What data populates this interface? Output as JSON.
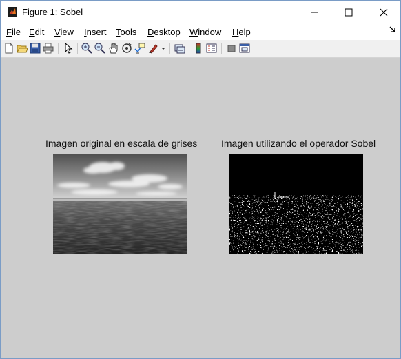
{
  "window": {
    "title": "Figure 1: Sobel"
  },
  "menu": {
    "items": [
      {
        "label": "File",
        "mnemonic": "F",
        "rest": "ile"
      },
      {
        "label": "Edit",
        "mnemonic": "E",
        "rest": "dit"
      },
      {
        "label": "View",
        "mnemonic": "V",
        "rest": "iew"
      },
      {
        "label": "Insert",
        "mnemonic": "I",
        "rest": "nsert"
      },
      {
        "label": "Tools",
        "mnemonic": "T",
        "rest": "ools"
      },
      {
        "label": "Desktop",
        "mnemonic": "D",
        "rest": "esktop"
      },
      {
        "label": "Window",
        "mnemonic": "W",
        "rest": "indow"
      },
      {
        "label": "Help",
        "mnemonic": "H",
        "rest": "elp"
      }
    ]
  },
  "toolbar": {
    "icons": [
      "new-figure-icon",
      "open-file-icon",
      "save-icon",
      "print-icon",
      "edit-plot-arrow-icon",
      "zoom-in-icon",
      "zoom-out-icon",
      "pan-hand-icon",
      "rotate-3d-icon",
      "data-cursor-icon",
      "brush-icon",
      "brush-dropdown-icon",
      "link-plot-icon",
      "insert-colorbar-icon",
      "insert-legend-icon",
      "hide-plot-tools-icon",
      "show-plot-tools-icon"
    ]
  },
  "axes": [
    {
      "title": "Imagen original en escala de grises",
      "content": "grayscale-sea-photo"
    },
    {
      "title": "Imagen utilizando el operador Sobel",
      "content": "sobel-edge-map"
    }
  ],
  "colors": {
    "figure_bg": "#cdcdcd",
    "edge_bg": "#000000",
    "edge_fg": "#ffffff"
  }
}
